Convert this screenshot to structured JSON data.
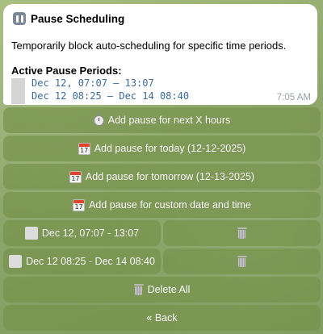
{
  "message": {
    "title": "Pause Scheduling",
    "description": "Temporarily block auto-scheduling for specific time periods.",
    "section_title": "Active Pause Periods:",
    "periods": [
      "Dec 12, 07:07 – 13:07",
      "Dec 12 08:25 – Dec 14 08:40"
    ],
    "time": "7:05 AM"
  },
  "keyboard": {
    "add_next_hours": "Add pause for next X hours",
    "add_today": "Add pause for today (12-12-2025)",
    "add_tomorrow": "Add pause for tomorrow (12-13-2025)",
    "add_custom": "Add pause for custom date and time",
    "pause_row_1": "Dec 12, 07:07 - 13:07",
    "pause_row_2": "Dec 12 08:25 - Dec 14 08:40",
    "delete_all": "Delete All",
    "back": "« Back",
    "calendar_day": "17"
  },
  "icons": {
    "title": "pause-icon",
    "next_hours": "stopwatch-icon",
    "calendar": "calendar-icon",
    "period": "grey-square-icon",
    "delete": "trash-icon"
  },
  "colors": {
    "button_bg": "#76914c",
    "period_text": "#3d6a9c",
    "time_text": "#9aa0a6"
  }
}
